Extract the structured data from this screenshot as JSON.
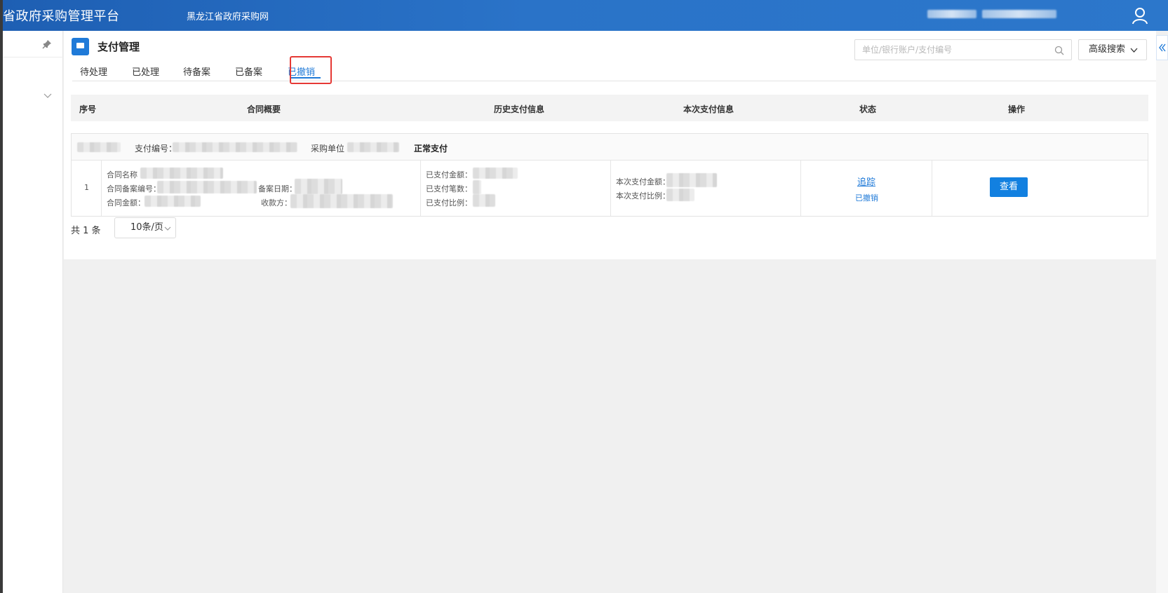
{
  "header": {
    "platform_title": "省政府采购管理平台",
    "site_link": "黑龙江省政府采购网",
    "user_icon": "user-icon"
  },
  "sidebar": {
    "pin_icon": "pin-icon",
    "expand_icon": "chevron-down-icon"
  },
  "page": {
    "title": "支付管理",
    "title_icon": "monitor-icon"
  },
  "tabs": [
    {
      "label": "待处理",
      "active": false
    },
    {
      "label": "已处理",
      "active": false
    },
    {
      "label": "待备案",
      "active": false
    },
    {
      "label": "已备案",
      "active": false
    },
    {
      "label": "已撤销",
      "active": true
    }
  ],
  "search": {
    "placeholder": "单位/银行账户/支付编号",
    "advanced_label": "高级搜索"
  },
  "table": {
    "headers": [
      "序号",
      "合同概要",
      "历史支付信息",
      "本次支付信息",
      "状态",
      "操作"
    ],
    "groups": [
      {
        "payment_no_label": "支付编号：",
        "purchaser_label": "采购单位",
        "payment_type": "正常支付",
        "row": {
          "index": "1",
          "contract_name_label": "合同名称",
          "contract_record_no_label": "合同备案编号：",
          "record_date_label": "备案日期：",
          "contract_amount_label": "合同金额：",
          "payee_label": "收款方：",
          "paid_amount_label": "已支付金额：",
          "paid_count_label": "已支付笔数：",
          "paid_ratio_label": "已支付比例：",
          "current_amount_label": "本次支付金额：",
          "current_ratio_label": "本次支付比例：",
          "track_link": "追踪",
          "status": "已撤销",
          "view_button": "查看"
        }
      }
    ]
  },
  "pagination": {
    "total_text": "共 1 条",
    "page_size": "10条/页"
  },
  "colors": {
    "header_blue": "#2a73c8",
    "accent": "#1f7ad8",
    "highlight_red": "#e53935"
  }
}
